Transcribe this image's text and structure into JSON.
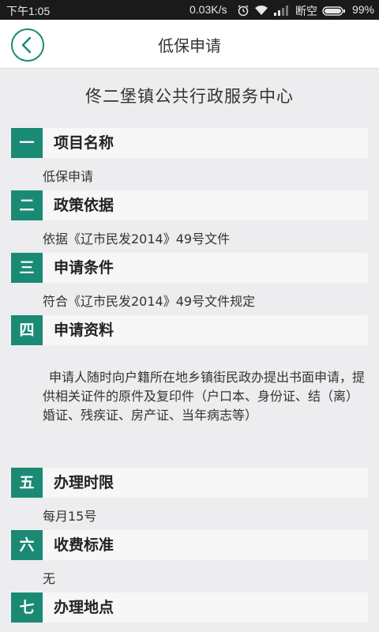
{
  "status_bar": {
    "time": "下午1:05",
    "speed": "0.03K/s",
    "carrier": "断空",
    "battery": "99%"
  },
  "header": {
    "title": "低保申请"
  },
  "main": {
    "center_name": "佟二堡镇公共行政服务中心",
    "sections": [
      {
        "num": "一",
        "title": "项目名称",
        "value": "低保申请"
      },
      {
        "num": "二",
        "title": "政策依据",
        "value": "依据《辽市民发2014》49号文件"
      },
      {
        "num": "三",
        "title": "申请条件",
        "value": "符合《辽市民发2014》49号文件规定"
      },
      {
        "num": "四",
        "title": "申请资料",
        "value": "申请人随时向户籍所在地乡镇街民政办提出书面申请，提供相关证件的原件及复印件（户口本、身份证、结（离）婚证、残疾证、房产证、当年病志等）"
      },
      {
        "num": "五",
        "title": "办理时限",
        "value": "每月15号"
      },
      {
        "num": "六",
        "title": "收费标准",
        "value": "无"
      },
      {
        "num": "七",
        "title": "办理地点",
        "value": ""
      }
    ]
  },
  "colors": {
    "accent": "#1a8a74",
    "header_bg": "#ffffff",
    "page_bg": "#ededf0"
  }
}
